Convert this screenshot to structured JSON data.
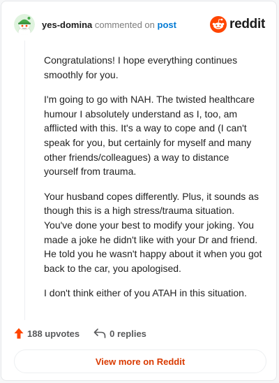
{
  "comment": {
    "username": "yes-domina",
    "action_text": "commented on",
    "link_text": "post",
    "paragraphs": [
      "Congratulations! I hope everything continues smoothly for you.",
      "I'm going to go with NAH. The twisted healthcare humour I absolutely understand as I, too, am afflicted with this. It's a way to cope and (I can't speak for you, but certainly for myself and many other friends/colleagues) a way to distance yourself from trauma.",
      "Your husband copes differently. Plus, it sounds as though this is a high stress/trauma situation. You've done your best to modify your joking. You made a joke he didn't like with your Dr and friend. He told you he wasn't happy about it when you got back to the car, you apologised.",
      "I don't think either of you ATAH in this situation."
    ]
  },
  "brand": {
    "wordmark": "reddit",
    "color": "#ff4500"
  },
  "footer": {
    "upvotes": "188 upvotes",
    "replies": "0 replies"
  },
  "cta": {
    "label": "View more on Reddit"
  },
  "icons": {
    "avatar": "snoo-avatar-icon",
    "brand": "reddit-logo-icon",
    "upvote": "upvote-arrow-icon",
    "reply": "reply-arrow-icon"
  }
}
